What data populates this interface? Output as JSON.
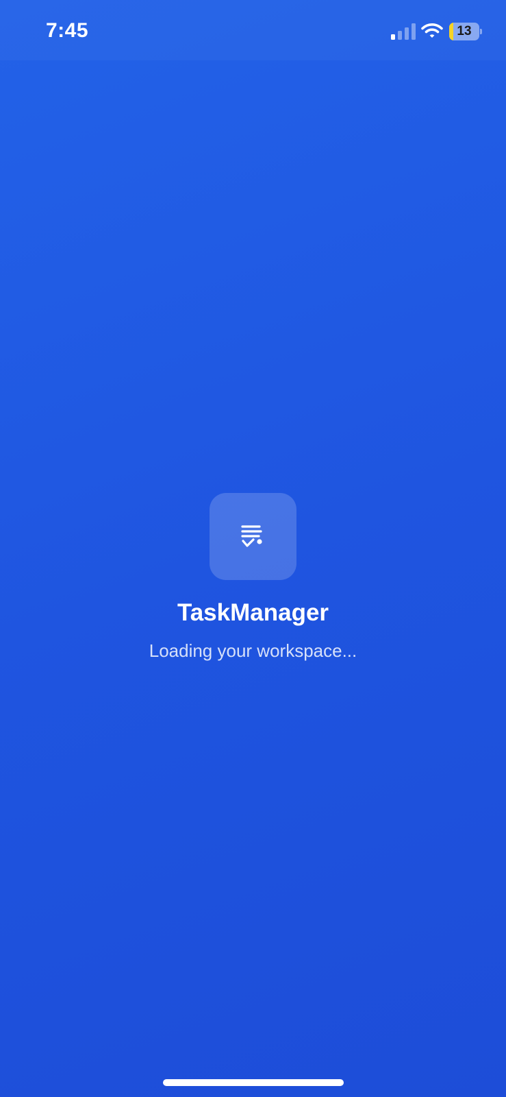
{
  "status_bar": {
    "time": "7:45",
    "signal_icon": "cellular-signal-icon",
    "signal_bars_active": 1,
    "signal_bars_total": 4,
    "wifi_icon": "wifi-icon",
    "battery_level": "13",
    "battery_fraction": 0.13,
    "battery_fill_color": "#F5D327"
  },
  "splash": {
    "logo_icon": "task-list-check-icon",
    "app_name": "TaskManager",
    "loading_message": "Loading your workspace..."
  },
  "colors": {
    "background_top": "#2362E8",
    "background_bottom": "#1D4DD8",
    "text": "#FFFFFF"
  }
}
